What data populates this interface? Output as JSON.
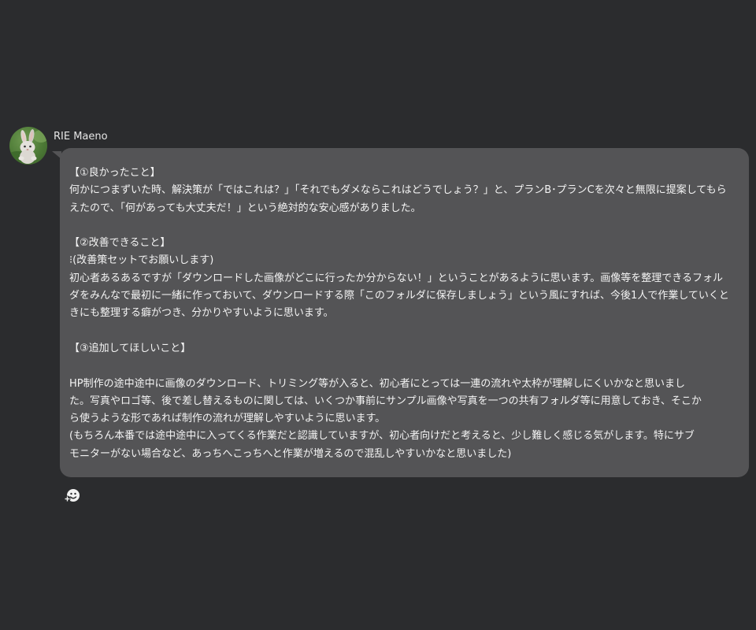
{
  "message": {
    "sender": "RIE Maeno",
    "avatar_icon": "rabbit-plush-avatar",
    "bubble_color": "#545456",
    "background_color": "#2b2c2e",
    "lines": {
      "l1": "【①良かったこと】",
      "l2": "何かにつまずいた時、解決策が「ではこれは？」「それでもダメならこれはどうでしょう？」と、プランB･プランCを次々と無限に提案してもら",
      "l3": "えたので、「何があっても大丈夫だ！」という絶対的な安心感がありました。",
      "l4": "【②改善できること】",
      "l5": "⁝(改善策セットでお願いします)",
      "l6": "初心者あるあるですが「ダウンロードした画像がどこに行ったか分からない！」ということがあるように思います。画像等を整理できるフォル",
      "l7": "ダをみんなで最初に一緒に作っておいて、ダウンロードする際「このフォルダに保存しましょう」という風にすれば、今後1人で作業していくと",
      "l8": "きにも整理する癖がつき、分かりやすいように思います。",
      "l9": "【③追加してほしいこと】",
      "l10": "HP制作の途中途中に画像のダウンロード、トリミング等が入ると、初心者にとっては一連の流れや太枠が理解しにくいかなと思いまし",
      "l11": "た。写真やロゴ等、後で差し替えるものに関しては、いくつか事前にサンプル画像や写真を一つの共有フォルダ等に用意しておき、そこか",
      "l12": "ら使うような形であれば制作の流れが理解しやすいように思います。",
      "l13": "(もちろん本番では途中途中に入ってくる作業だと認識していますが、初心者向けだと考えると、少し難しく感じる気がします。特にサブ",
      "l14": "モニターがない場合など、あっちへこっちへと作業が増えるので混乱しやすいかなと思いました)"
    },
    "reaction_icon": "add-reaction-icon"
  }
}
